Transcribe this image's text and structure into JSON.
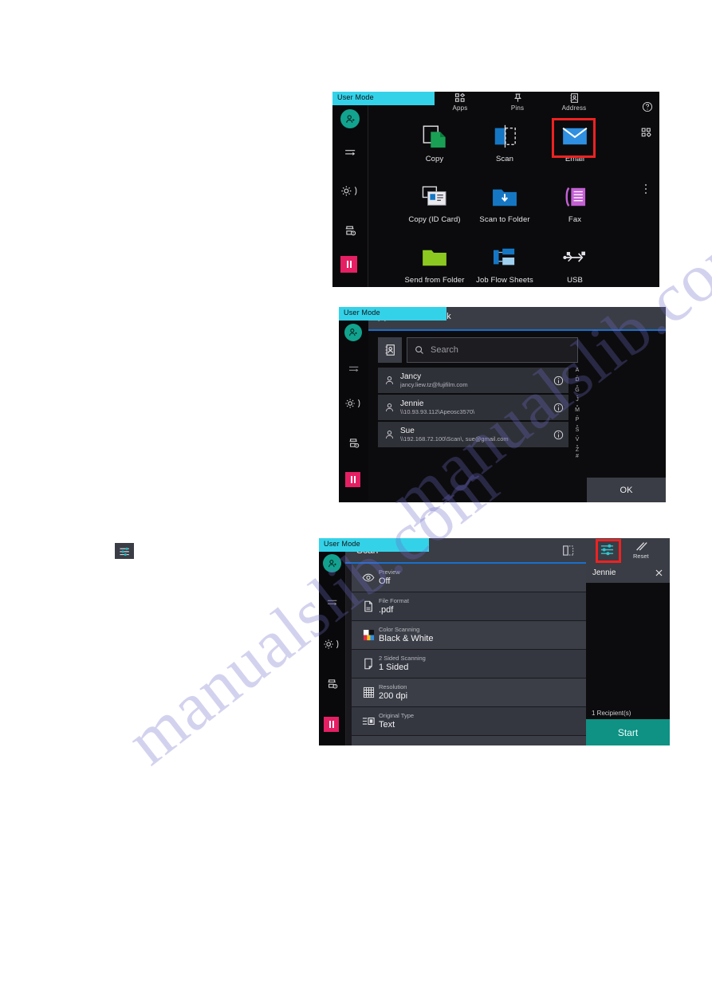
{
  "page": {
    "watermark": "manualslib.com"
  },
  "panel_apps": {
    "user_mode_label": "User Mode",
    "topnav": [
      {
        "label": "Apps",
        "icon": "apps-grid-icon"
      },
      {
        "label": "Pins",
        "icon": "pin-icon"
      },
      {
        "label": "Address",
        "icon": "address-book-icon"
      }
    ],
    "help_icon": "help-circle-icon",
    "app_config_icon": "apps-config-icon",
    "more_icon": "more-vertical-icon",
    "apps": [
      {
        "label": "Copy",
        "icon": "copy-icon"
      },
      {
        "label": "Scan",
        "icon": "scan-icon"
      },
      {
        "label": "Email",
        "icon": "email-icon"
      },
      {
        "label": "Copy (ID Card)",
        "icon": "id-card-icon"
      },
      {
        "label": "Scan to Folder",
        "icon": "scan-to-folder-icon"
      },
      {
        "label": "Fax",
        "icon": "fax-icon"
      },
      {
        "label": "Send from Folder",
        "icon": "folder-icon"
      },
      {
        "label": "Job Flow Sheets",
        "icon": "job-flow-icon"
      },
      {
        "label": "USB",
        "icon": "usb-icon"
      }
    ],
    "highlight_color": "#ee2222",
    "highlighted_app": "Email",
    "rail": {
      "avatar_icon": "user-avatar-icon",
      "items": [
        {
          "icon": "job-feed-icon"
        },
        {
          "icon": "gear-icon"
        },
        {
          "icon": "printer-status-icon"
        }
      ],
      "pause_icon": "pause-icon"
    }
  },
  "panel_address_book": {
    "user_mode_label": "User Mode",
    "close_icon": "close-icon",
    "title": "Address Book",
    "book_button_icon": "address-book-icon",
    "search": {
      "icon": "search-icon",
      "placeholder": "Search",
      "value": ""
    },
    "contacts": [
      {
        "name": "Jancy",
        "detail": "jancy.liew.tz@fujifilm.com",
        "avatar_icon": "person-icon",
        "info_icon": "info-icon"
      },
      {
        "name": "Jennie",
        "detail": "\\\\10.93.93.112\\Apeosc3570\\",
        "avatar_icon": "person-icon",
        "info_icon": "info-icon"
      },
      {
        "name": "Sue",
        "detail": "\\\\192.168.72.100\\Scan\\, sue@gmail.com",
        "avatar_icon": "person-icon",
        "info_icon": "info-icon"
      }
    ],
    "index_letters": [
      "A",
      "D",
      "G",
      "J",
      "M",
      "P",
      "S",
      "V",
      "Z",
      "#"
    ],
    "ok_label": "OK",
    "rail": {
      "avatar_icon": "user-avatar-icon",
      "items": [
        {
          "icon": "job-feed-icon"
        },
        {
          "icon": "gear-icon"
        },
        {
          "icon": "printer-status-icon"
        }
      ],
      "pause_icon": "pause-icon"
    }
  },
  "panel_scan": {
    "user_mode_label": "User Mode",
    "title": "Scan",
    "toolbar": [
      {
        "label": "",
        "icon": "original-size-icon"
      },
      {
        "label": "",
        "icon": "sliders-icon"
      },
      {
        "label": "Reset",
        "icon": "reset-icon"
      }
    ],
    "highlight_color": "#ee2222",
    "highlighted_tool": "sliders-icon",
    "settings": [
      {
        "key": "Preview",
        "value": "Off",
        "icon": "eye-icon"
      },
      {
        "key": "File Format",
        "value": ".pdf",
        "icon": "file-icon"
      },
      {
        "key": "Color Scanning",
        "value": "Black & White",
        "icon": "color-palette-icon"
      },
      {
        "key": "2 Sided Scanning",
        "value": "1 Sided",
        "icon": "two-sided-icon"
      },
      {
        "key": "Resolution",
        "value": "200 dpi",
        "icon": "grid-icon"
      },
      {
        "key": "Original Type",
        "value": "Text",
        "icon": "original-type-icon"
      }
    ],
    "recipient": {
      "name": "Jennie",
      "remove_icon": "close-icon",
      "count_label": "1 Recipient(s)"
    },
    "start_label": "Start",
    "start_color": "#0f9184",
    "rail": {
      "avatar_icon": "user-avatar-icon",
      "items": [
        {
          "icon": "job-feed-icon"
        },
        {
          "icon": "gear-icon"
        },
        {
          "icon": "printer-status-icon"
        }
      ],
      "pause_icon": "pause-icon"
    }
  },
  "standalone_icon": {
    "name": "sliders-icon"
  }
}
